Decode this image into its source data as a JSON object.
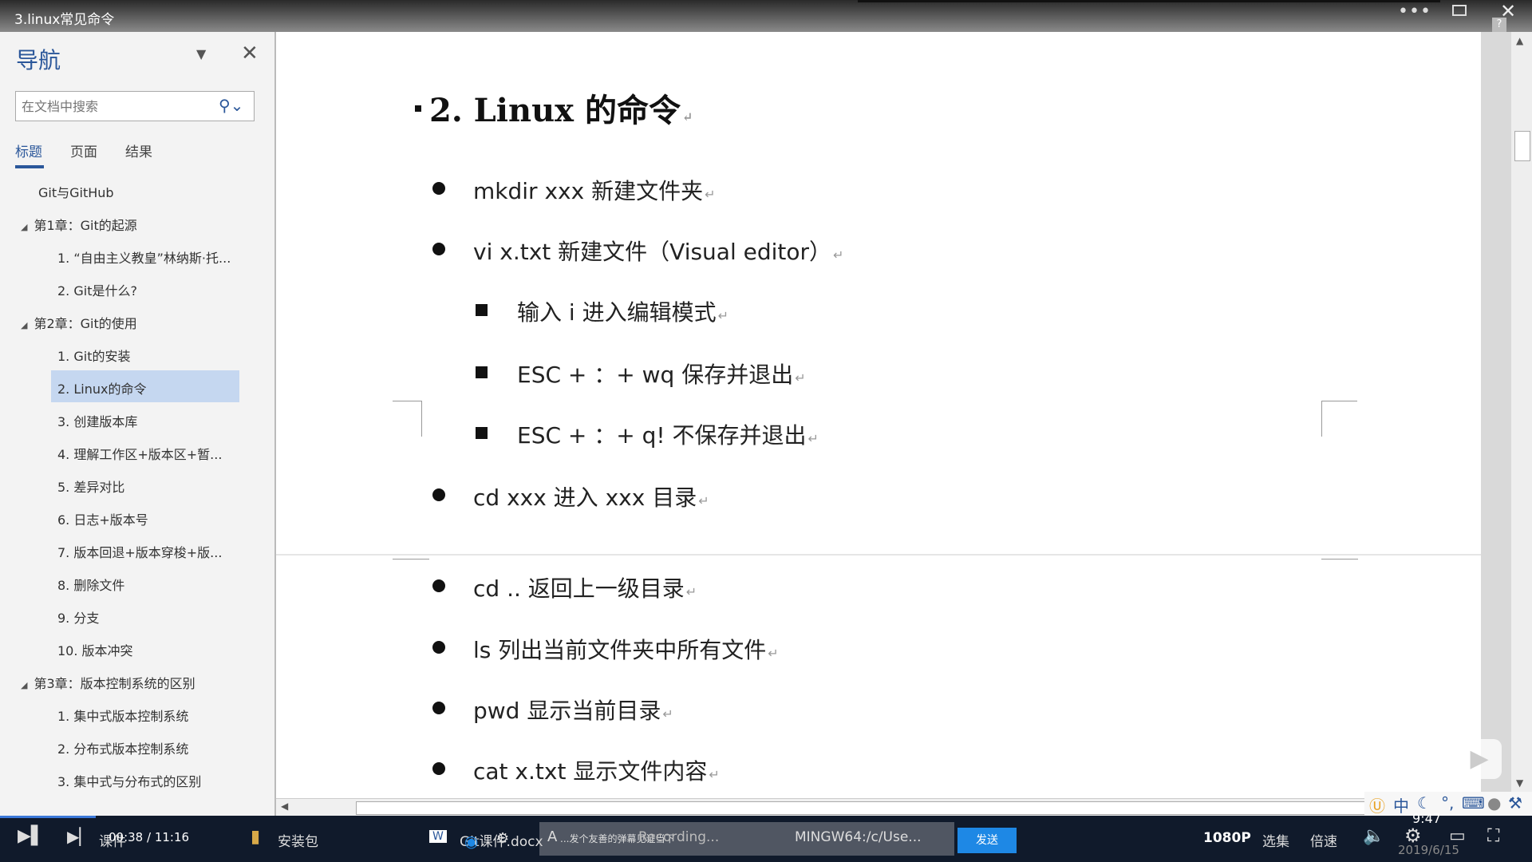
{
  "window": {
    "title": "3.linux常见命令",
    "close": "✕",
    "help": "?"
  },
  "nav": {
    "heading": "导航",
    "search_placeholder": "在文档中搜索",
    "tabs": [
      "标题",
      "页面",
      "结果"
    ],
    "items": [
      {
        "label": "Git与GitHub"
      },
      {
        "label": "第1章：Git的起源"
      },
      {
        "label": "1. “自由主义教皇”林纳斯·托..."
      },
      {
        "label": "2.  Git是什么?"
      },
      {
        "label": "第2章：Git的使用"
      },
      {
        "label": "1.  Git的安装"
      },
      {
        "label": "2. Linux的命令"
      },
      {
        "label": "3. 创建版本库"
      },
      {
        "label": "4. 理解工作区+版本区+暂..."
      },
      {
        "label": "5.  差异对比"
      },
      {
        "label": "6. 日志+版本号"
      },
      {
        "label": "7. 版本回退+版本穿梭+版..."
      },
      {
        "label": "8. 删除文件"
      },
      {
        "label": "9. 分支"
      },
      {
        "label": "10. 版本冲突"
      },
      {
        "label": "第3章：版本控制系统的区别"
      },
      {
        "label": "1. 集中式版本控制系统"
      },
      {
        "label": "2. 分布式版本控制系统"
      },
      {
        "label": "3. 集中式与分布式的区别"
      }
    ]
  },
  "document": {
    "heading": "2. Linux 的命令",
    "page1_items": [
      "mkdir xxx 新建文件夹",
      "vi x.txt 新建文件（Visual editor）",
      "输入  i  进入编辑模式",
      "ESC +  ：+ wq  保存并退出",
      "ESC +  ：+ q!  不保存并退出",
      "cd xxx 进入 xxx 目录"
    ],
    "page2_items": [
      "cd .. 返回上一级目录",
      "ls 列出当前文件夹中所有文件",
      "pwd 显示当前目录",
      "cat x.txt  显示文件内容"
    ],
    "paragraph_mark": "↵"
  },
  "ime": {
    "label": "中"
  },
  "taskbar": {
    "time_played": "00:38 / 11:16",
    "prefix": "课件",
    "folder": "安装包",
    "word_doc": "Git课件.docx",
    "recording": "Recording...",
    "mingw": "MINGW64:/c/Use...",
    "chat_placeholder": "...发个友善的弹幕见证当下",
    "send": "发送",
    "quality": "1080P",
    "select": "选集",
    "speed": "倍速",
    "clock": "9:47",
    "date": "2019/6/15"
  }
}
